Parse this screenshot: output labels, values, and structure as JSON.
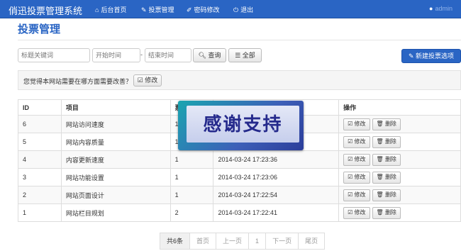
{
  "navbar": {
    "brand": "俏迅投票管理系统",
    "items": [
      {
        "icon": "home-icon",
        "label": "后台首页"
      },
      {
        "icon": "vote-icon",
        "label": "投票管理"
      },
      {
        "icon": "pencil-icon",
        "label": "密码修改"
      },
      {
        "icon": "power-icon",
        "label": "退出"
      }
    ],
    "user": {
      "icon": "user-icon",
      "name": "admin"
    }
  },
  "page": {
    "title": "投票管理"
  },
  "filters": {
    "keyword_placeholder": "标题关键词",
    "start_placeholder": "开始时间",
    "dash": "-",
    "end_placeholder": "结束时间",
    "search_label": "查询",
    "all_label": "全部",
    "new_label": "新建投票选项"
  },
  "suggest": {
    "question": "您觉得本网站需要在哪方面需要改善？",
    "edit_label": "修改"
  },
  "table": {
    "headers": [
      "ID",
      "项目",
      "票",
      "",
      "操作"
    ],
    "rows": [
      {
        "id": "6",
        "item": "网站访问速度",
        "votes": "1",
        "time": ""
      },
      {
        "id": "5",
        "item": "网站内容质量",
        "votes": "1",
        "time": ""
      },
      {
        "id": "4",
        "item": "内容更新速度",
        "votes": "1",
        "time": "2014-03-24 17:23:36"
      },
      {
        "id": "3",
        "item": "网站功能设置",
        "votes": "1",
        "time": "2014-03-24 17:23:06"
      },
      {
        "id": "2",
        "item": "网站页面设计",
        "votes": "1",
        "time": "2014-03-24 17:22:54"
      },
      {
        "id": "1",
        "item": "网站栏目规划",
        "votes": "2",
        "time": "2014-03-24 17:22:41"
      }
    ],
    "edit_label": "修改",
    "delete_label": "删除"
  },
  "pagination": {
    "total": "共6条",
    "first": "首页",
    "prev": "上一页",
    "page": "1",
    "next": "下一页",
    "last": "尾页"
  },
  "overlay": {
    "text": "感谢支持"
  },
  "colors": {
    "primary": "#2a65c4",
    "overlay_text": "#252a8c"
  }
}
